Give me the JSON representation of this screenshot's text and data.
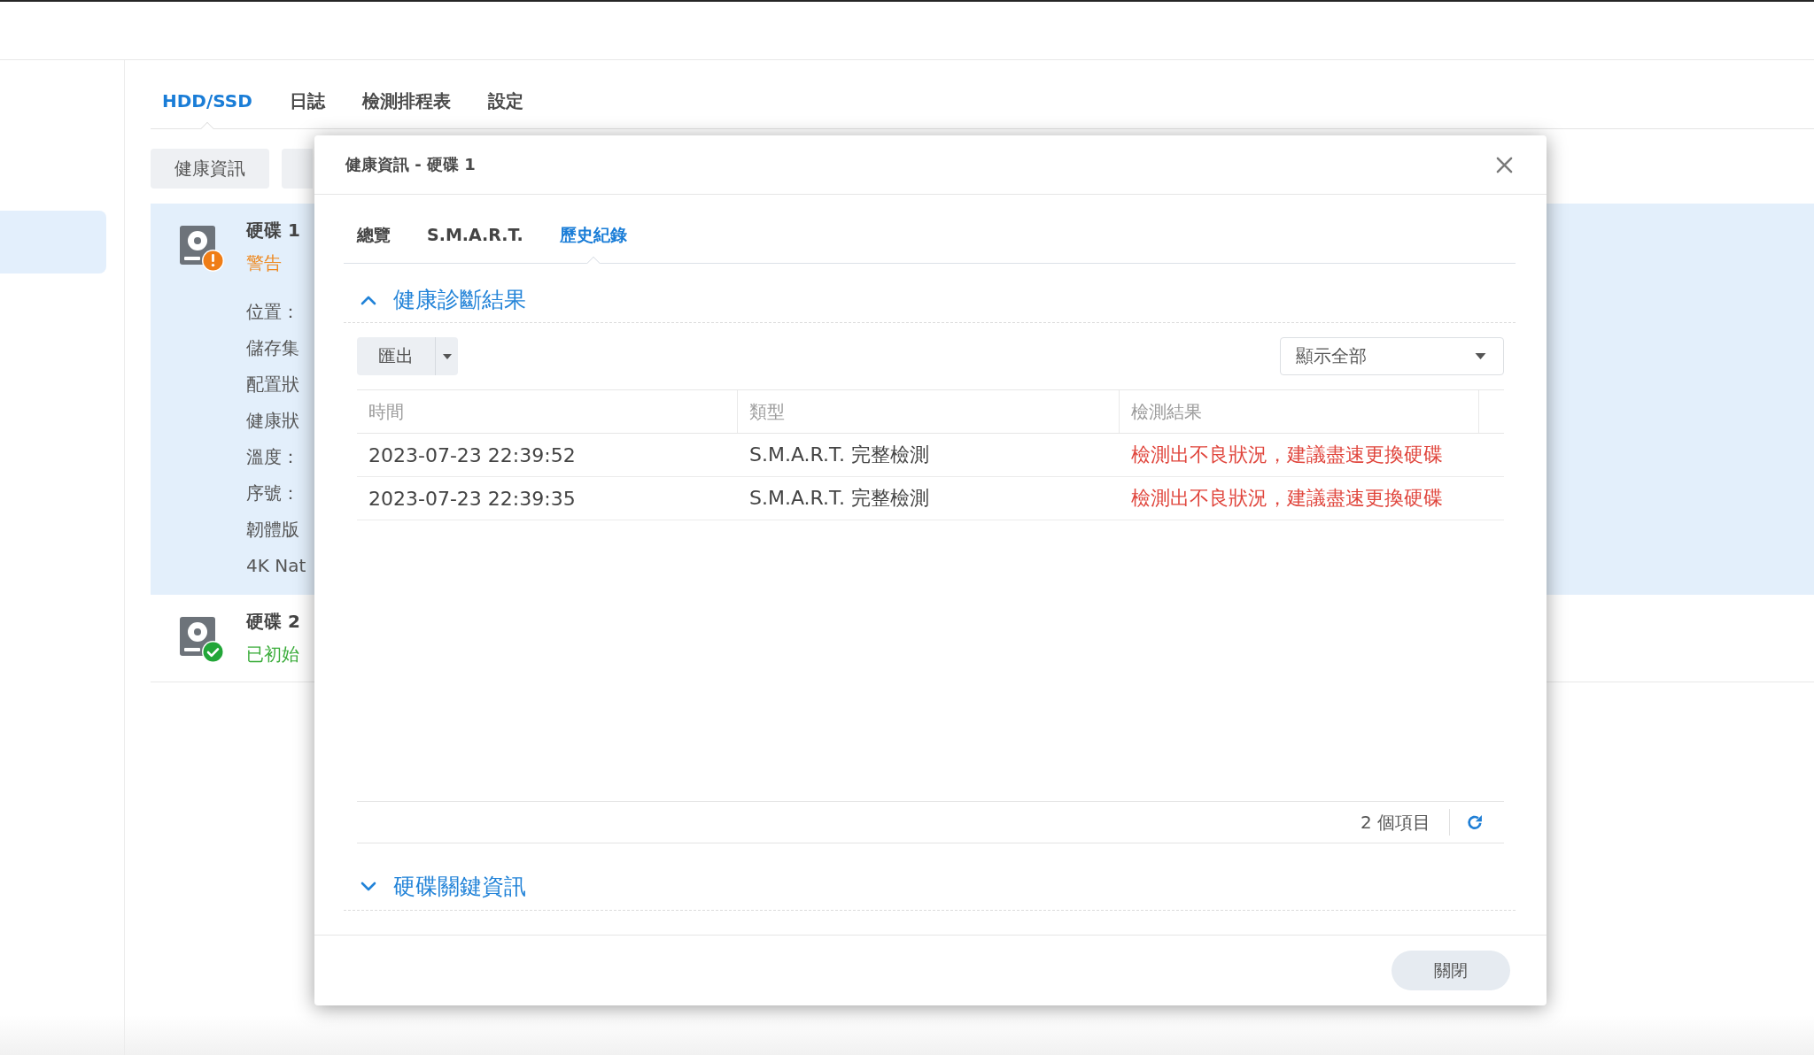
{
  "sidebar": {
    "items": [
      {
        "selected": true
      }
    ]
  },
  "tabs": [
    {
      "label": "HDD/SSD",
      "selected": true
    },
    {
      "label": "日誌",
      "selected": false
    },
    {
      "label": "檢測排程表",
      "selected": false
    },
    {
      "label": "設定",
      "selected": false
    }
  ],
  "toolbar": {
    "buttons": [
      "健康資訊"
    ]
  },
  "disks": [
    {
      "name": "硬碟 1",
      "kind": "warning",
      "status": "警告",
      "selected": true,
      "details": [
        "位置：",
        "儲存集",
        "配置狀",
        "健康狀",
        "溫度：",
        "序號：",
        "韌體版",
        "4K Nat"
      ]
    },
    {
      "name": "硬碟 2",
      "kind": "healthy",
      "status": "已初始",
      "selected": false
    }
  ],
  "dialog": {
    "title": "健康資訊 - 硬碟 1",
    "tabs": [
      {
        "label": "總覽",
        "selected": false
      },
      {
        "label": "S.M.A.R.T.",
        "selected": false
      },
      {
        "label": "歷史紀錄",
        "selected": true
      }
    ],
    "sections": [
      {
        "title": "健康診斷結果",
        "expanded": true,
        "export_button": "匯出",
        "filter": {
          "value": "顯示全部"
        },
        "table": {
          "columns": [
            "時間",
            "類型",
            "檢測結果"
          ],
          "rows": [
            {
              "time": "2023-07-23 22:39:52",
              "type": "S.M.A.R.T. 完整檢測",
              "result": "檢測出不良狀況，建議盡速更換硬碟",
              "failed": true
            },
            {
              "time": "2023-07-23 22:39:35",
              "type": "S.M.A.R.T. 完整檢測",
              "result": "檢測出不良狀況，建議盡速更換硬碟",
              "failed": true
            }
          ]
        },
        "item_count": "2 個項目"
      },
      {
        "title": "硬碟關鍵資訊",
        "expanded": false
      }
    ],
    "buttons": [
      "關閉"
    ]
  }
}
